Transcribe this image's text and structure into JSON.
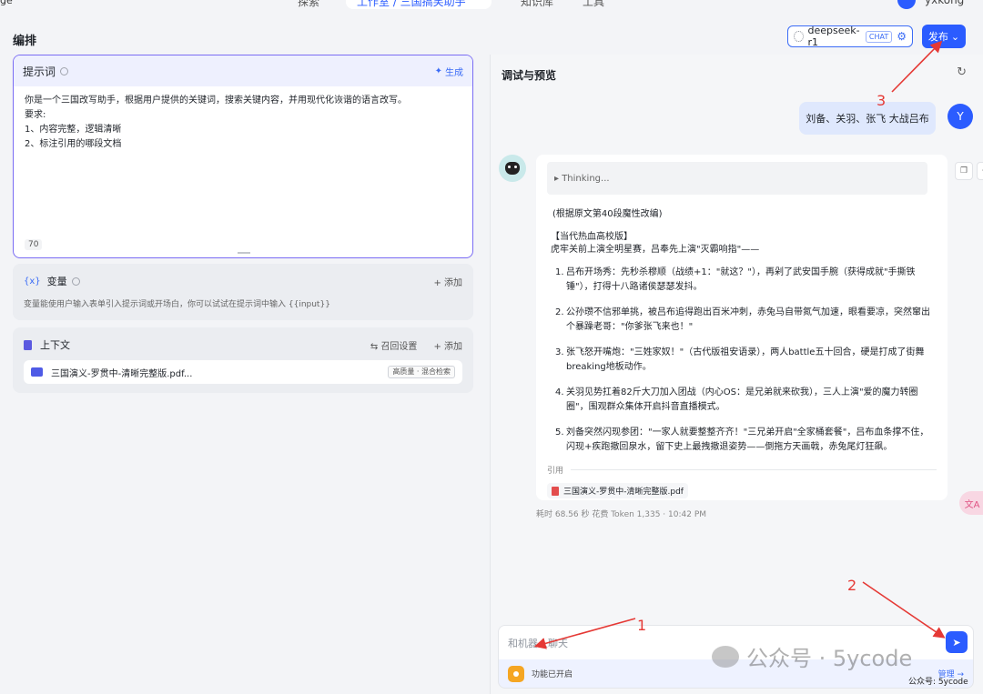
{
  "topnav": {
    "brand_fragment": "ge",
    "items": [
      "探索",
      "工作室 / 三国搞笑助手",
      "知识库",
      "工具"
    ],
    "user": "yxkong"
  },
  "header": {
    "title": "编排",
    "model_name": "deepseek-r1",
    "model_tag": "CHAT",
    "publish_label": "发布"
  },
  "prompt": {
    "title": "提示词",
    "generate_label": "生成",
    "lines": [
      "你是一个三国改写助手，根据用户提供的关键词，搜索关键内容，并用现代化诙谐的语言改写。",
      "要求:",
      "1、内容完整，逻辑清晰",
      "2、标注引用的哪段文档"
    ],
    "char_count": "70"
  },
  "variables": {
    "title": "变量",
    "add_label": "+ 添加",
    "description": "变量能使用户输入表单引入提示词或开场白，你可以试试在提示词中输入 {{input}}"
  },
  "context": {
    "title": "上下文",
    "recall_label": "召回设置",
    "add_label": "+ 添加",
    "file_name": "三国演义-罗贯中-清晰完整版.pdf...",
    "file_tag": "高质量 · 混合检索"
  },
  "debug": {
    "title": "调试与预览",
    "user_avatar": "Y",
    "user_message": "刘备、关羽、张飞 大战吕布",
    "thinking_label": "▸ Thinking...",
    "source_note": "(根据原文第40段魔性改编)",
    "section_head": "【当代热血高校版】",
    "section_intro": "虎牢关前上演全明星赛，吕奉先上演\"灭霸响指\"——",
    "items": [
      "吕布开场秀：先秒杀穆顺（战绩+1：\"就这？\"），再剁了武安国手腕（获得成就\"手撕铁锤\"），打得十八路诸侯瑟瑟发抖。",
      "公孙瓒不信邪单挑，被吕布追得跑出百米冲刺，赤兔马自带氮气加速，眼看要凉，突然窜出个暴躁老哥：\"你爹张飞来也！\"",
      "张飞怒开嘴炮：\"三姓家奴！\"（古代版祖安语录），两人battle五十回合，硬是打成了街舞breaking地板动作。",
      "关羽见势扛着82斤大刀加入团战（内心OS：是兄弟就来砍我），三人上演\"爱的魔力转圈圈\"，围观群众集体开启抖音直播模式。",
      "刘备突然闪现参团：\"一家人就要整整齐齐！\"三兄弟开启\"全家桶套餐\"，吕布血条撑不住，闪现+疾跑撤回泉水，留下史上最拽撤退姿势——倒拖方天画戟，赤兔尾灯狂飙。"
    ],
    "cite_label": "引用",
    "cite_file": "三国演义-罗贯中-清晰完整版.pdf",
    "meta": "耗时 68.56 秒  花费 Token 1,335  ·  10:42 PM",
    "float_label": "文A",
    "input_placeholder": "和机器人聊天",
    "feature_label": "功能已开启",
    "manage_label": "管理 →"
  },
  "annotations": [
    "1",
    "2",
    "3"
  ],
  "watermark": {
    "text": "公众号 · 5ycode",
    "small": "公众号: 5ycode"
  },
  "colors": {
    "accent": "#2b5cff",
    "annotation": "#e53935",
    "prompt_border": "#7a6cf4"
  }
}
